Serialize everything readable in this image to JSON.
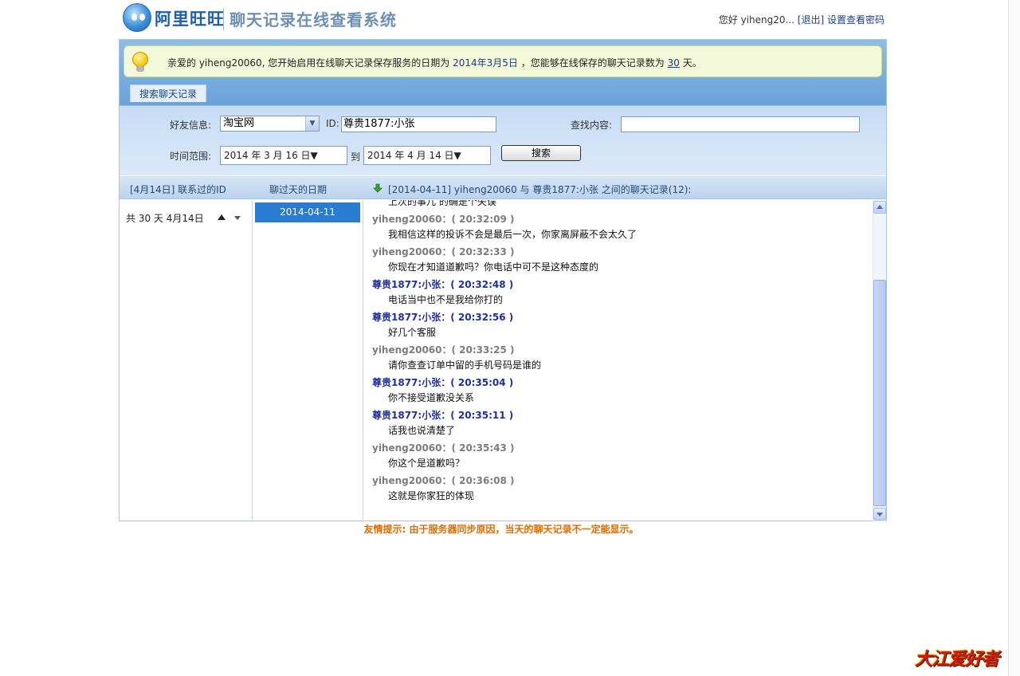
{
  "header": {
    "brand": "阿里旺旺",
    "system_title": "聊天记录在线查看系统",
    "greeting": "您好 yiheng20...",
    "logout_label": "[退出]",
    "set_password_label": "设置查看密码"
  },
  "notice": {
    "prefix": "亲爱的 yiheng20060, 您开始启用在线聊天记录保存服务的日期为",
    "start_date": "2014年3月5日",
    "middle": "，您能够在线保存的聊天记录数为",
    "count": "30",
    "suffix": "天。"
  },
  "tab": {
    "label": "搜索聊天记录"
  },
  "search": {
    "friend_label": "好友信息:",
    "friend_value": "淘宝网",
    "id_label": "ID:",
    "id_value": "尊贵1877:小张",
    "content_label": "查找内容:",
    "content_value": "",
    "time_label": "时间范围:",
    "from_date": "2014  年  3  月 16 日▼",
    "to_label": "到",
    "to_date": "2014  年  4  月 14 日▼",
    "search_button": "搜索"
  },
  "columns": {
    "ids_header": "[4月14日] 联系过的ID",
    "dates_header": "聊过天的日期",
    "chat_header": "[2014-04-11] yiheng20060 与 尊贵1877:小张 之间的聊天记录(12):"
  },
  "sidebar": {
    "days_summary": "共 30 天  4月14日"
  },
  "dates": [
    "2014-04-11"
  ],
  "chat": {
    "messages": [
      {
        "sender": "",
        "time": "",
        "text": "上次的事儿 的确是个失误",
        "who": "me"
      },
      {
        "sender": "yiheng20060：",
        "time": "( 20:32:09 )",
        "text": "我相信这样的投诉不会是最后一次，你家离屏蔽不会太久了",
        "who": "me"
      },
      {
        "sender": "yiheng20060：",
        "time": "( 20:32:33 )",
        "text": "你现在才知道道歉吗？你电话中可不是这种态度的",
        "who": "me"
      },
      {
        "sender": "尊贵1877:小张：",
        "time": "( 20:32:48 )",
        "text": "电话当中也不是我给你打的",
        "who": "other"
      },
      {
        "sender": "尊贵1877:小张：",
        "time": "( 20:32:56 )",
        "text": "好几个客服",
        "who": "other"
      },
      {
        "sender": "yiheng20060：",
        "time": "( 20:33:25 )",
        "text": "请你查查订单中留的手机号码是谁的",
        "who": "me"
      },
      {
        "sender": "尊贵1877:小张：",
        "time": "( 20:35:04 )",
        "text": "你不接受道歉没关系",
        "who": "other"
      },
      {
        "sender": "尊贵1877:小张：",
        "time": "( 20:35:11 )",
        "text": "话我也说清楚了",
        "who": "other"
      },
      {
        "sender": "yiheng20060：",
        "time": "( 20:35:43 )",
        "text": "你这个是道歉吗？",
        "who": "me"
      },
      {
        "sender": "yiheng20060：",
        "time": "( 20:36:08 )",
        "text": "这就是你家狂的体现",
        "who": "me"
      }
    ]
  },
  "footer_tip": "友情提示: 由于服务器同步原因，当天的聊天记录不一定能显示。",
  "watermark": "大江爱好者"
}
